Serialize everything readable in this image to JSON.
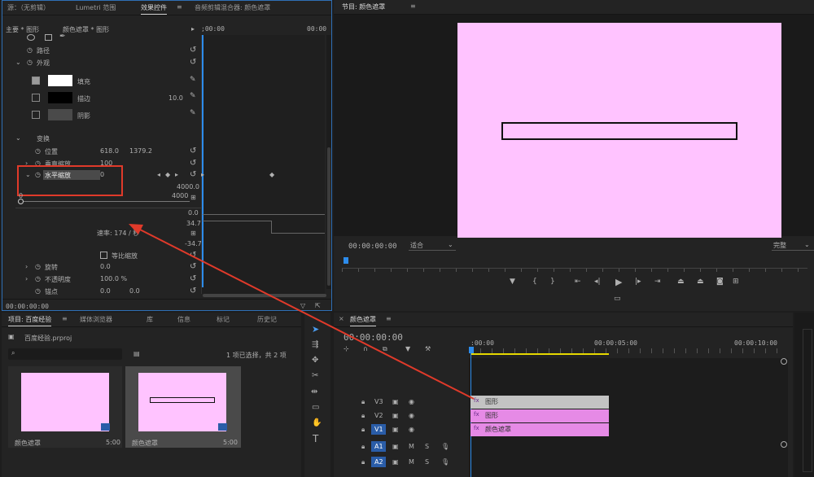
{
  "colors": {
    "accent": "#2d8ceb",
    "pink": "#ffc3ff",
    "clip_pink": "#e68ae6",
    "clip_gray": "#c3c3c3",
    "arrow_red": "#e03a2a",
    "highlight_box": "#e03a2a",
    "yellow_bar": "#e6d800"
  },
  "top_tabs": {
    "source": "源：（无剪辑）",
    "lumetri": "Lumetri 范围",
    "effect_controls": "效果控件",
    "audio_mixer": "音频剪辑混合器: 颜色遮罩",
    "program": "节目: 颜色遮罩"
  },
  "effect_controls": {
    "master": "主要 * 图形",
    "clip": "颜色遮罩 * 图形",
    "time_left": ";00:00",
    "time_right": "00:00",
    "path_label": "路径",
    "appearance_label": "外观",
    "fill_label": "填充",
    "stroke_label": "描边",
    "stroke_value": "10.0",
    "shadow_label": "阴影",
    "transform_label": "变换",
    "position_label": "位置",
    "position_x": "618.0",
    "position_y": "1379.2",
    "vertical_scale_label": "垂直缩放",
    "vertical_scale_value": "100",
    "horizontal_scale_label": "水平缩放",
    "horizontal_scale_value": "0",
    "graph_top_value": "4000.0",
    "slider_max": "4000",
    "slider_min": "0",
    "graph_zero": "0.0",
    "velocity_top": "34.7",
    "velocity_bottom": "-34.7",
    "velocity_label": "速率: 174 / 秒",
    "uniform_scale_label": "等比缩放",
    "rotation_label": "旋转",
    "rotation_value": "0.0",
    "opacity_label": "不透明度",
    "opacity_value": "100.0 %",
    "anchor_label": "锚点",
    "anchor_x": "0.0",
    "anchor_y": "0.0",
    "timecode": "00:00:00:00"
  },
  "program": {
    "timecode": "00:00:00:00",
    "fit": "适合",
    "quality": "完整"
  },
  "project": {
    "tabs": [
      "项目: 百度经验",
      "媒体浏览器",
      "库",
      "信息",
      "标记",
      "历史记"
    ],
    "file": "百度经验.prproj",
    "selection_info": "1 项已选择，共 2 项",
    "items": [
      {
        "name": "颜色遮罩",
        "duration": "5:00"
      },
      {
        "name": "颜色遮罩",
        "duration": "5:00"
      }
    ]
  },
  "timeline": {
    "tab": "颜色遮罩",
    "timecode": "00:00:00:00",
    "ruler": [
      ":00:00",
      "00:00:05:00",
      "00:00:10:00"
    ],
    "tracks": [
      {
        "name": "V3"
      },
      {
        "name": "V2"
      },
      {
        "name": "V1"
      },
      {
        "name": "A1"
      },
      {
        "name": "A2"
      }
    ],
    "clips": [
      {
        "label": "图形",
        "track": "V3"
      },
      {
        "label": "图形",
        "track": "V2"
      },
      {
        "label": "颜色遮罩",
        "track": "V1"
      }
    ],
    "track_m": "M",
    "track_s": "S"
  }
}
